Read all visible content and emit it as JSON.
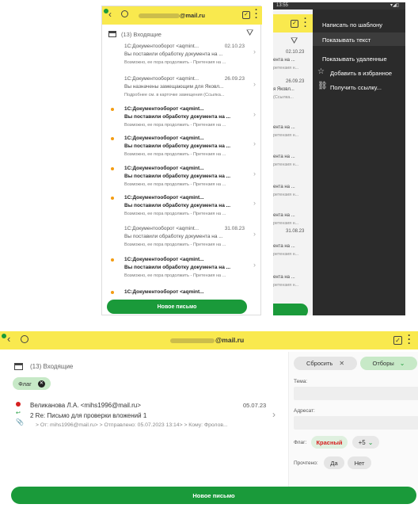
{
  "left_screen": {
    "account": "@mail.ru",
    "folder": "(13) Входящие",
    "messages": [
      {
        "sender": "1С:Документооборот <aqmint...",
        "date": "02.10.23",
        "subject": "Вы поставили обработку документа на ...",
        "preview": "Возможно, ее пора продолжить - Претензия на ...",
        "unread": false
      },
      {
        "sender": "1С:Документооборот <aqmint...",
        "date": "26.09.23",
        "subject": "Вы назначены замещающим для Яковл...",
        "preview": "Подробнее см. в карточке замещения (Ссылка...",
        "unread": false
      },
      {
        "sender": "1С:Документооборот <aqmint...",
        "date": "",
        "subject": "Вы поставили обработку документа на ...",
        "preview": "Возможно, ее пора продолжить - Претензия на ...",
        "unread": true
      },
      {
        "sender": "1С:Документооборот <aqmint...",
        "date": "",
        "subject": "Вы поставили обработку документа на ...",
        "preview": "Возможно, ее пора продолжить - Претензия на ...",
        "unread": true
      },
      {
        "sender": "1С:Документооборот <aqmint...",
        "date": "",
        "subject": "Вы поставили обработку документа на ...",
        "preview": "Возможно, ее пора продолжить - Претензия на ...",
        "unread": true
      },
      {
        "sender": "1С:Документооборот <aqmint...",
        "date": "",
        "subject": "Вы поставили обработку документа на ...",
        "preview": "Возможно, ее пора продолжить - Претензия на ...",
        "unread": true
      },
      {
        "sender": "1С:Документооборот <aqmint...",
        "date": "31.08.23",
        "subject": "Вы поставили обработку документа на ...",
        "preview": "Возможно, ее пора продолжить - Претензия на ...",
        "unread": false
      },
      {
        "sender": "1С:Документооборот <aqmint...",
        "date": "",
        "subject": "Вы поставили обработку документа на ...",
        "preview": "Возможно, ее пора продолжить - Претензия на ...",
        "unread": true
      },
      {
        "sender": "1С:Документооборот <aqmint...",
        "date": "",
        "subject": "",
        "preview": "",
        "unread": true
      }
    ],
    "new_letter": "Новое письмо"
  },
  "right_screen": {
    "time": "13:55",
    "menu": [
      "Написать по шаблону",
      "Показывать текст",
      "Показывать удаленные",
      "Добавить в избранное",
      "Получить ссылку..."
    ],
    "dates": [
      "02.10.23",
      "26.09.23",
      "31.08.23"
    ],
    "snippets": [
      "ента на ...",
      "ретензия н...",
      "я Яковл...",
      "(Ссылка..."
    ]
  },
  "bottom_screen": {
    "account": "@mail.ru",
    "folder": "(13) Входящие",
    "flag_chip": "Флаг",
    "reset": "Сбросить",
    "filters": "Отборы",
    "message": {
      "sender": "Великанова Л.А. <mihs1996@mail.ru>",
      "date": "05.07.23",
      "subject": "2 Re: Письмо для проверки вложений 1",
      "meta": "> От: mihs1996@mail.ru> > Отправлено: 05.07.2023 13:14> > Кому: Фролов..."
    },
    "filter_panel": {
      "topic_label": "Тема:",
      "addressee_label": "Адресат:",
      "flag_label": "Флаг:",
      "flag_value": "Красный",
      "more": "+5",
      "read_label": "Прочтено:",
      "yes": "Да",
      "no": "Нет"
    },
    "new_letter": "Новое письмо"
  },
  "colors": {
    "yellow": "#f9e94e",
    "green": "#1a9a3a",
    "orange": "#f39c12",
    "red": "#d62020",
    "dark": "#2b2b2b"
  }
}
